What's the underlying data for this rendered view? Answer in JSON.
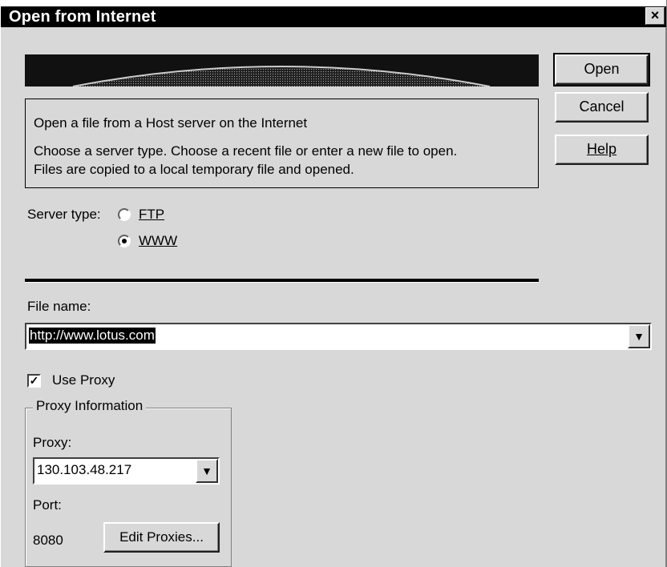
{
  "window": {
    "title": "Open from Internet",
    "close_glyph": "×"
  },
  "buttons": {
    "open": "Open",
    "cancel": "Cancel",
    "help": "Help"
  },
  "info": {
    "line1": "Open a file from a Host server on the Internet",
    "line2": "Choose a server type. Choose a recent file or enter a new file to open.",
    "line3": "Files are copied to a local temporary file and opened."
  },
  "server_type": {
    "label": "Server type:",
    "options": [
      {
        "label": "FTP",
        "selected": false
      },
      {
        "label": "WWW",
        "selected": true
      }
    ]
  },
  "file_name": {
    "label": "File name:",
    "value": "http://www.lotus.com"
  },
  "use_proxy": {
    "label": "Use Proxy",
    "checked": true
  },
  "proxy_info": {
    "group_title": "Proxy Information",
    "proxy_label": "Proxy:",
    "proxy_value": "130.103.48.217",
    "port_label": "Port:",
    "port_value": "8080",
    "edit_button": "Edit Proxies..."
  },
  "icons": {
    "dropdown": "chevron-down-icon",
    "check": "checkmark-icon"
  }
}
